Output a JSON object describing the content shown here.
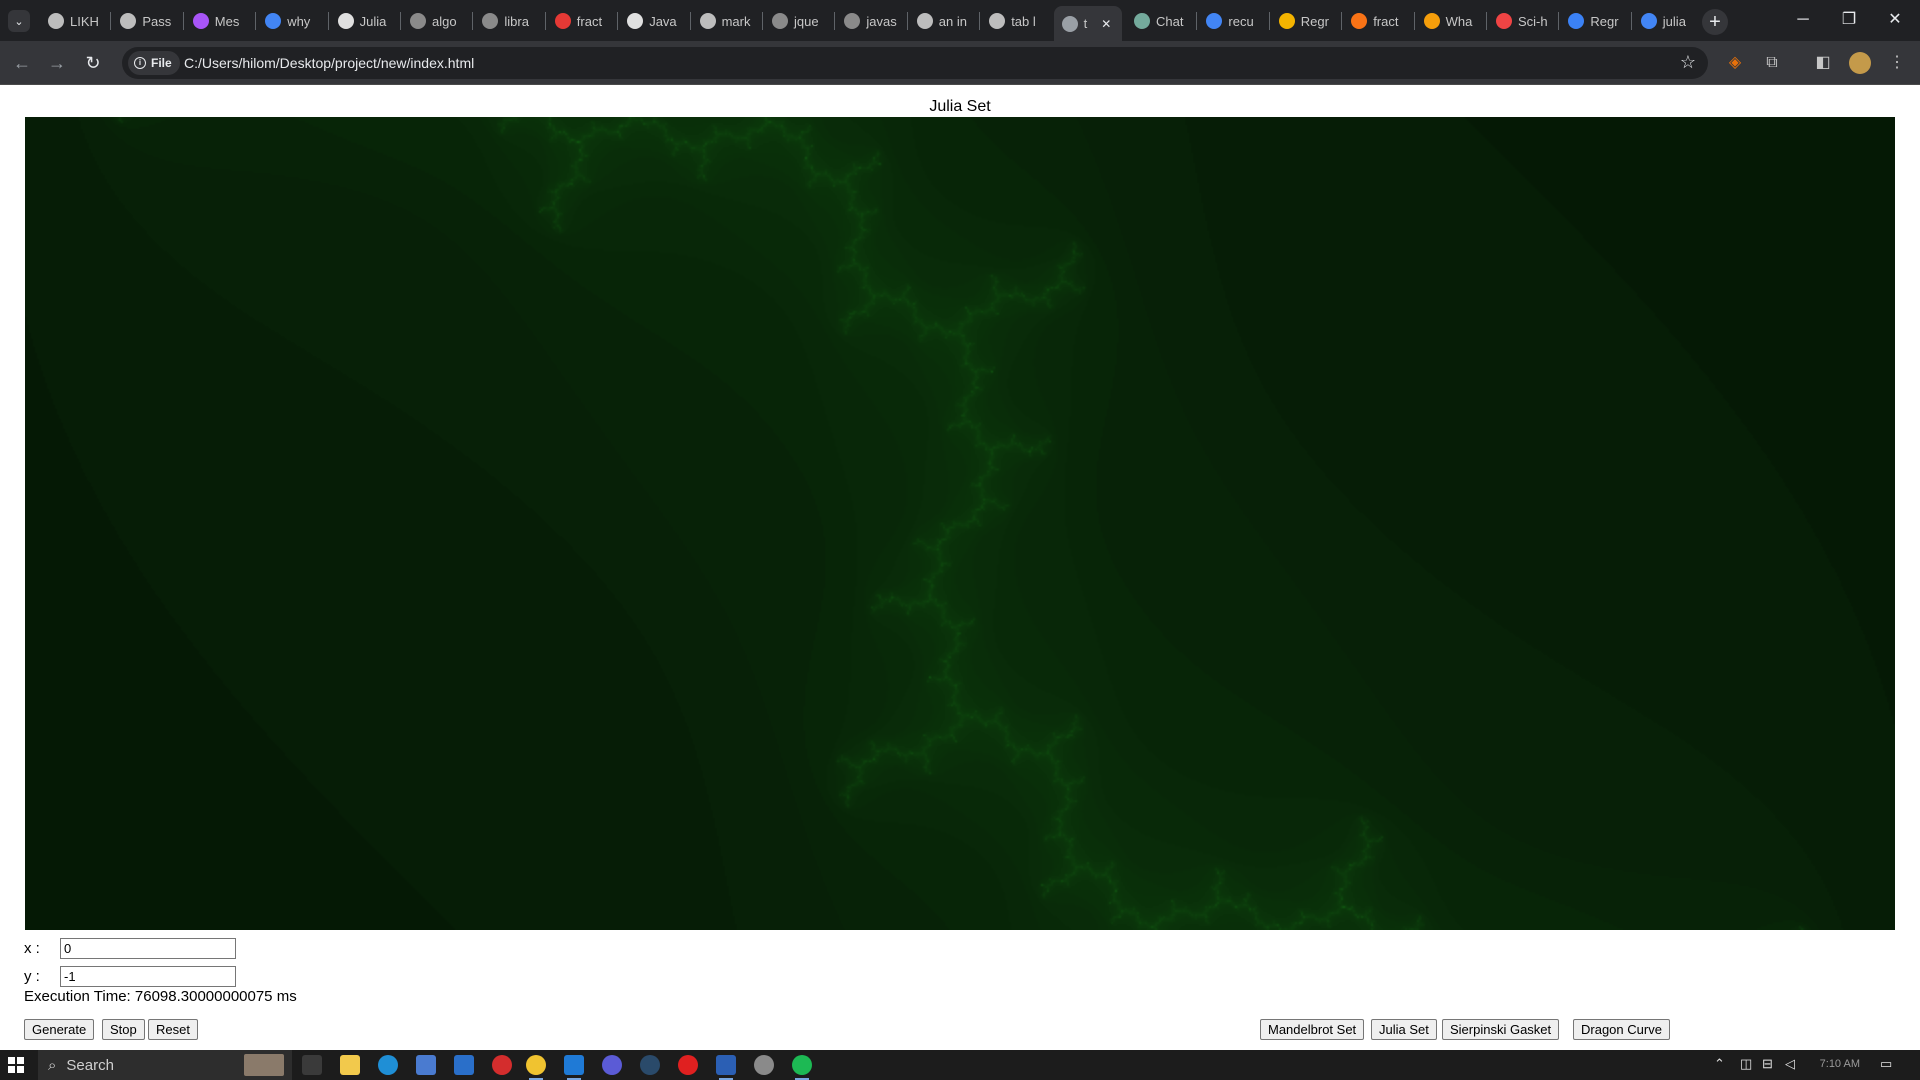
{
  "browser": {
    "tabs": [
      {
        "label": "LIKH",
        "favicon_color": "#bdbdbd"
      },
      {
        "label": "Pass",
        "favicon_color": "#bdbdbd"
      },
      {
        "label": "Mes",
        "favicon_color": "#a855f7"
      },
      {
        "label": "why",
        "favicon_color": "#4285f4"
      },
      {
        "label": "Julia",
        "favicon_color": "#e0e0e0"
      },
      {
        "label": "algo",
        "favicon_color": "#8a8a8a"
      },
      {
        "label": "libra",
        "favicon_color": "#8a8a8a"
      },
      {
        "label": "fract",
        "favicon_color": "#e53935"
      },
      {
        "label": "Java",
        "favicon_color": "#e0e0e0"
      },
      {
        "label": "mark",
        "favicon_color": "#bdbdbd"
      },
      {
        "label": "jque",
        "favicon_color": "#8a8a8a"
      },
      {
        "label": "javas",
        "favicon_color": "#8a8a8a"
      },
      {
        "label": "an in",
        "favicon_color": "#bdbdbd"
      },
      {
        "label": "tab l",
        "favicon_color": "#bdbdbd"
      },
      {
        "label": "t",
        "favicon_color": "#9aa0a6",
        "active": true
      },
      {
        "label": "Chat",
        "favicon_color": "#74aa9c"
      },
      {
        "label": "recu",
        "favicon_color": "#4285f4"
      },
      {
        "label": "Regr",
        "favicon_color": "#f4b400"
      },
      {
        "label": "fract",
        "favicon_color": "#f97316"
      },
      {
        "label": "Wha",
        "favicon_color": "#f59e0b"
      },
      {
        "label": "Sci-h",
        "favicon_color": "#ef4444"
      },
      {
        "label": "Regr",
        "favicon_color": "#3b82f6"
      },
      {
        "label": "julia",
        "favicon_color": "#4285f4"
      }
    ],
    "close_tab_glyph": "✕",
    "new_tab_glyph": "+",
    "file_chip_label": "File",
    "url": "C:/Users/hilom/Desktop/project/new/index.html"
  },
  "page": {
    "title": "Julia Set",
    "x_label": "x :",
    "x_value": "0",
    "y_label": "y :",
    "y_value": "-1",
    "execution_time": "Execution Time: 76098.30000000075 ms",
    "buttons": {
      "generate": "Generate",
      "stop": "Stop",
      "reset": "Reset",
      "mandelbrot": "Mandelbrot Set",
      "julia": "Julia Set",
      "sierpinski": "Sierpinski Gasket",
      "dragon": "Dragon Curve"
    }
  },
  "fractal": {
    "type": "julia",
    "c_re": 0,
    "c_im": -1,
    "background_color": "#041204",
    "glow_color": "#1e7a1e"
  },
  "taskbar": {
    "search_placeholder": "Search",
    "clock": "7:10 AM"
  }
}
